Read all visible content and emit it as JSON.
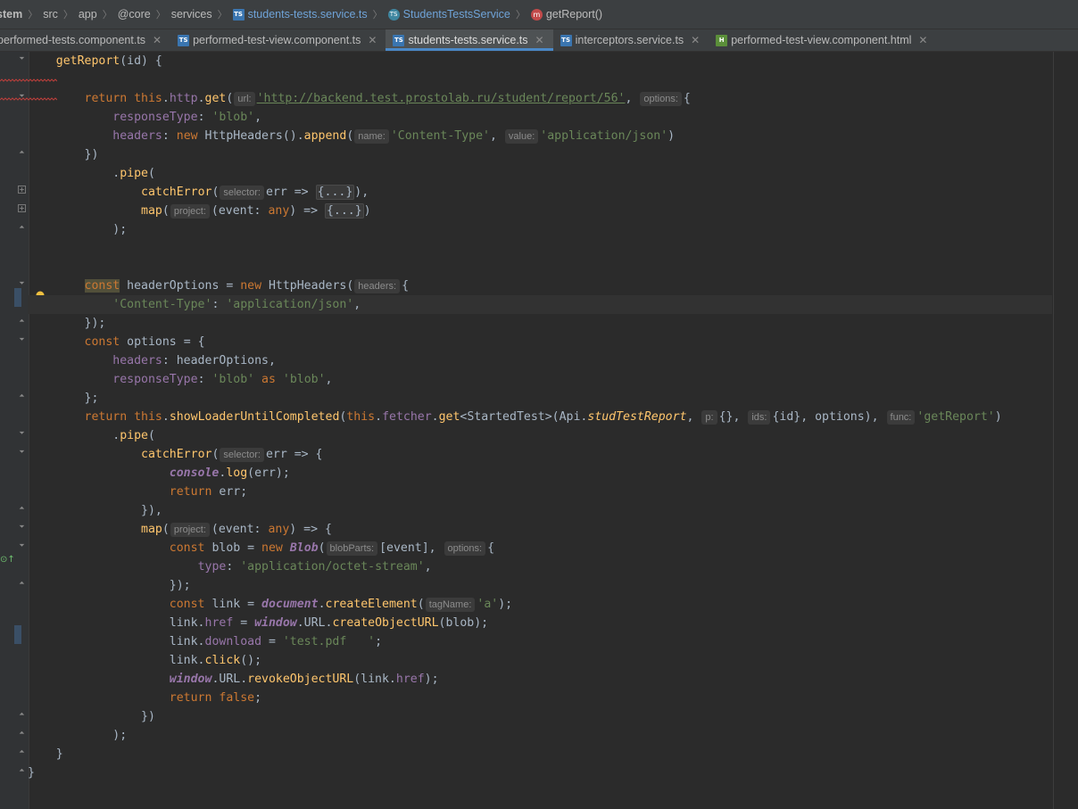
{
  "breadcrumb": {
    "root": "stem",
    "items": [
      "src",
      "app",
      "@core",
      "services"
    ],
    "file": "students-tests.service.ts",
    "class": "StudentsTestsService",
    "method": "getReport()"
  },
  "tabs": [
    {
      "label": "performed-tests.component.ts",
      "icon": "ts-file-icon",
      "active": false
    },
    {
      "label": "performed-test-view.component.ts",
      "icon": "ts-file-icon",
      "active": false
    },
    {
      "label": "students-tests.service.ts",
      "icon": "ts-file-icon",
      "active": true
    },
    {
      "label": "interceptors.service.ts",
      "icon": "ts-file-icon",
      "active": false
    },
    {
      "label": "performed-test-view.component.html",
      "icon": "html-file-icon",
      "active": false
    }
  ],
  "hints": {
    "url": "url:",
    "options": "options:",
    "name": "name:",
    "value": "value:",
    "selector": "selector:",
    "project": "project:",
    "headers": "headers:",
    "p": "p:",
    "ids": "ids:",
    "func": "func:",
    "blobParts": "blobParts:",
    "tagName": "tagName:"
  },
  "code": {
    "method_name": "getReport",
    "url_string": "'http://backend.test.prostolab.ru/student/report/56'",
    "blob_str": "'blob'",
    "content_type_str": "'Content-Type'",
    "app_json_str": "'application/json'",
    "octet_stream_str": "'application/octet-stream'",
    "a_str": "'a'",
    "test_pdf_str": "'test.pdf   '",
    "get_report_str": "'getReport'",
    "folded": "{...}"
  },
  "colors": {
    "background": "#2b2b2b",
    "keyword": "#cc7832",
    "string": "#6a8759",
    "function": "#ffc66d",
    "property": "#9876aa",
    "text": "#a9b7c6",
    "active_tab_underline": "#4a88c7"
  }
}
